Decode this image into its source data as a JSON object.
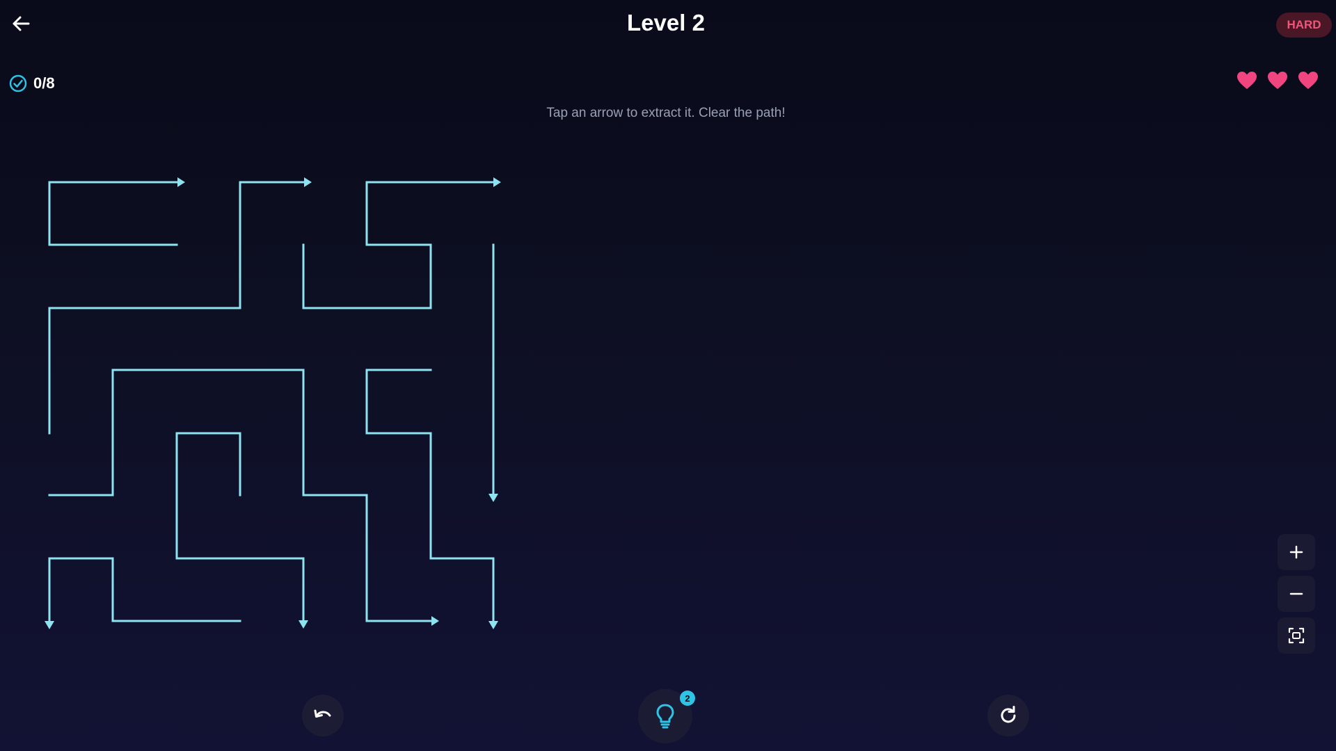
{
  "header": {
    "title": "Level 2",
    "difficulty": "HARD",
    "back_icon": "arrow-left-icon"
  },
  "status": {
    "progress": "0/8",
    "progress_icon": "check-circle-icon",
    "lives_remaining": 3,
    "lives_total": 3,
    "life_icon": "heart-icon"
  },
  "instructions": "Tap an arrow to extract it. Clear the path!",
  "controls": {
    "zoom_in_icon": "plus-icon",
    "zoom_out_icon": "minus-icon",
    "fit_icon": "fit-screen-icon",
    "undo_icon": "undo-icon",
    "hint_icon": "lightbulb-icon",
    "hint_count": "2",
    "restart_icon": "restart-icon"
  },
  "colors": {
    "background": "#0d0f22",
    "arrow_line": "#8ee3f0",
    "accent": "#2ec4e6",
    "heart": "#f0457f",
    "badge_bg": "#4a1726",
    "badge_text": "#f0567a"
  }
}
